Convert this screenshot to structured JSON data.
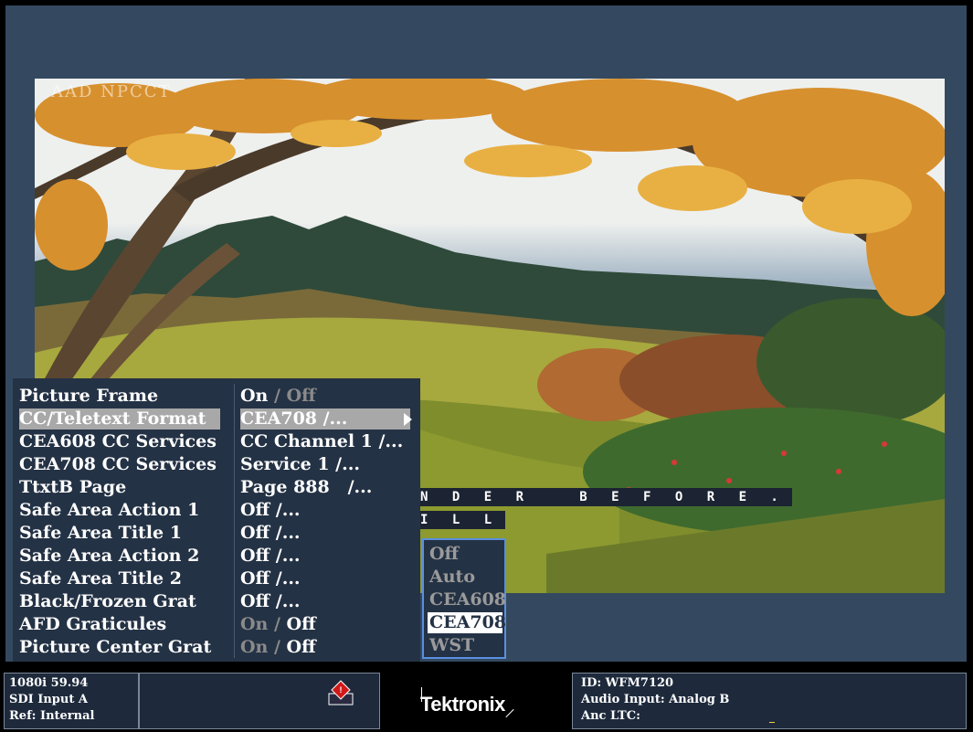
{
  "picture": {
    "overlay_text": "AAD NPCCT",
    "cc_line_1": "N D E R   B E F O R E .",
    "cc_line_2": "I L L"
  },
  "menu": {
    "rows": [
      {
        "label": "Picture Frame",
        "value_on": "On",
        "value_sep": " / ",
        "value_off": "Off",
        "active": "on"
      },
      {
        "label": "CC/Teletext Format",
        "value": "CEA708 /...",
        "selected": true
      },
      {
        "label": "CEA608 CC Services",
        "value": "CC Channel 1 /..."
      },
      {
        "label": "CEA708 CC Services",
        "value": "Service 1 /..."
      },
      {
        "label": "TtxtB Page",
        "value": "Page 888   /..."
      },
      {
        "label": "Safe Area Action 1",
        "value": "Off /..."
      },
      {
        "label": "Safe Area Title 1",
        "value": "Off /..."
      },
      {
        "label": "Safe Area Action 2",
        "value": "Off /..."
      },
      {
        "label": "Safe Area Title 2",
        "value": "Off /..."
      },
      {
        "label": "Black/Frozen Grat",
        "value": "Off /..."
      },
      {
        "label": "AFD Graticules",
        "value_on": "On",
        "value_sep": " / ",
        "value_off": "Off",
        "active": "off"
      },
      {
        "label": "Picture Center Grat",
        "value_on": "On",
        "value_sep": " / ",
        "value_off": "Off",
        "active": "off"
      }
    ]
  },
  "dropdown": {
    "options": [
      "Off",
      "Auto",
      "CEA608",
      "CEA708",
      "WST"
    ],
    "selected": "CEA708"
  },
  "status": {
    "format": "1080i 59.94",
    "input": "SDI Input A",
    "ref": "Ref: Internal",
    "brand": "Tektronix",
    "id": "ID: WFM7120",
    "audio": "Audio Input: Analog B",
    "anc": "Anc LTC:",
    "warning_icon": "warning-diamond-icon"
  },
  "colors": {
    "frame_bg": "#34495f",
    "menu_bg": "#243245",
    "highlight": "#a8a8a8",
    "dropdown_border": "#5b8fe0",
    "warning": "#d01818"
  }
}
